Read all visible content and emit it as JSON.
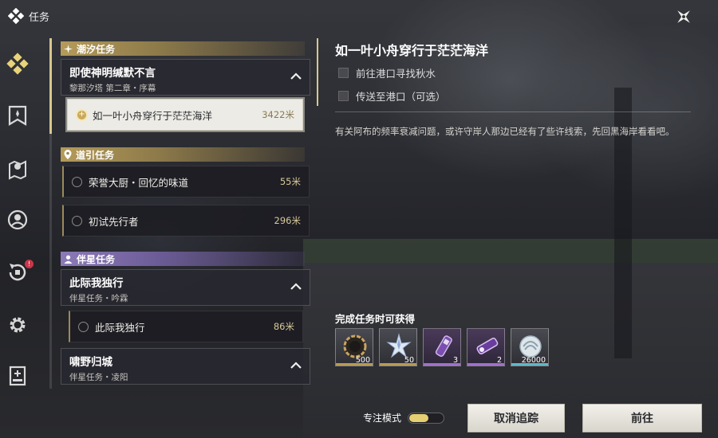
{
  "header": {
    "title": "任务",
    "close_icon": "x-star-icon"
  },
  "rail": {
    "items": [
      {
        "icon": "quest-diamond-icon",
        "active": true
      },
      {
        "icon": "shield-banner-icon"
      },
      {
        "icon": "map-pin-icon"
      },
      {
        "icon": "person-circle-icon"
      },
      {
        "icon": "return-arrow-icon",
        "badge": "!"
      },
      {
        "icon": "gear-icon"
      },
      {
        "icon": "archive-book-icon"
      }
    ]
  },
  "quest_list": {
    "categories": [
      {
        "label": "潮汐任务",
        "groups": [
          {
            "title": "即使神明缄默不言",
            "subtitle": "黎那汐塔 第二章・序幕",
            "quests": [
              {
                "name": "如一叶小舟穿行于茫茫海洋",
                "distance": "3422米",
                "selected": true
              }
            ]
          }
        ]
      },
      {
        "label": "道引任务",
        "quests": [
          {
            "name": "荣誉大厨・回忆的味道",
            "distance": "55米"
          },
          {
            "name": "初试先行者",
            "distance": "296米"
          }
        ]
      },
      {
        "label": "伴星任务",
        "groups": [
          {
            "title": "此际我独行",
            "subtitle": "伴星任务・吟霖",
            "quests": [
              {
                "name": "此际我独行",
                "distance": "86米"
              }
            ]
          },
          {
            "title": "啸野归城",
            "subtitle": "伴星任务・凌阳",
            "quests": []
          }
        ]
      }
    ]
  },
  "detail": {
    "title": "如一叶小舟穿行于茫茫海洋",
    "objectives": [
      "前往港口寻找秋水",
      "传送至港口（可选）"
    ],
    "description": "有关阿布的频率衰减问题，或许守岸人那边已经有了些许线索，先回黑海岸看看吧。",
    "rewards_label": "完成任务时可获得",
    "rewards": [
      {
        "icon": "coin-shell-icon",
        "count": "500",
        "rarity_color": "#b89a55"
      },
      {
        "icon": "star-crystal-icon",
        "count": "50",
        "rarity_color": "#b89a55"
      },
      {
        "icon": "purple-vial-icon",
        "count": "3",
        "rarity_color": "#a070c8"
      },
      {
        "icon": "purple-tube-icon",
        "count": "2",
        "rarity_color": "#a070c8"
      },
      {
        "icon": "shell-credit-icon",
        "count": "26000",
        "rarity_color": "#60b8c8"
      }
    ]
  },
  "footer": {
    "focus_mode_label": "专注模式",
    "focus_mode_on": true,
    "cancel_track_label": "取消追踪",
    "go_label": "前往"
  }
}
